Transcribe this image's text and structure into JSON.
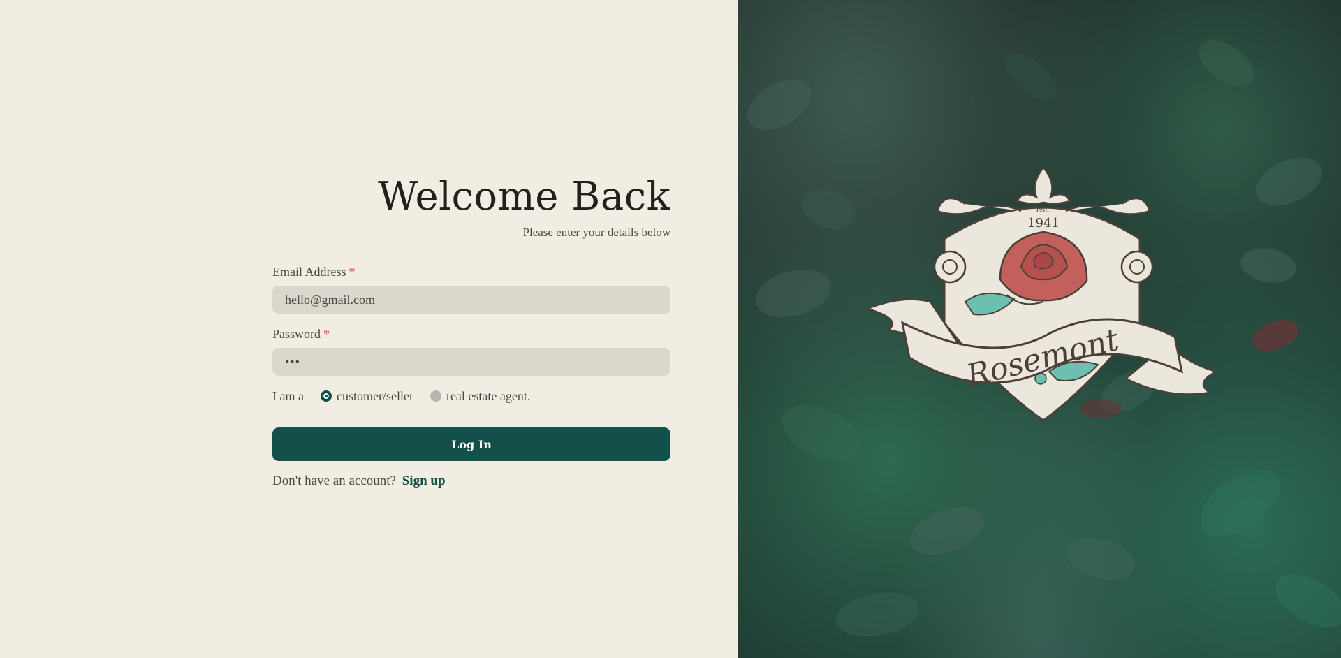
{
  "login": {
    "title": "Welcome Back",
    "subtitle": "Please enter your details below",
    "email_label": "Email Address",
    "email_value": "hello@gmail.com",
    "password_label": "Password",
    "password_value": "•••",
    "required_marker": "*",
    "role_prefix": "I am a",
    "role_options": [
      {
        "label": "customer/seller",
        "selected": true
      },
      {
        "label": "real estate agent.",
        "selected": false
      }
    ],
    "submit_label": "Log In",
    "signup_prompt": "Don't have an account?",
    "signup_link": "Sign up"
  },
  "brand": {
    "name": "Rosemont",
    "est_label": "est.",
    "est_year": "1941"
  },
  "colors": {
    "background": "#f2ede3",
    "accent": "#13504a",
    "input_bg": "#dbd7cd",
    "required": "#d15a56",
    "rose": "#c4605c",
    "leaf": "#6cc0b0"
  },
  "icons": {
    "crest": "rosemont-crest-logo",
    "rose": "rose-icon",
    "radio_selected": "radio-selected-icon",
    "radio_unselected": "radio-unselected-icon"
  }
}
